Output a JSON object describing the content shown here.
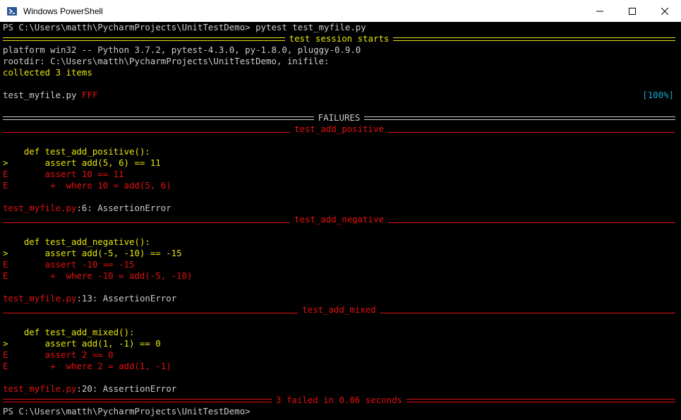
{
  "window": {
    "title": "Windows PowerShell",
    "icon": "powershell-icon",
    "controls": [
      "minimize-icon",
      "maximize-icon",
      "close-icon"
    ]
  },
  "console": {
    "prompt1": "PS C:\\Users\\matth\\PycharmProjects\\UnitTestDemo> pytest test_myfile.py",
    "session_header": "test session starts",
    "platform": "platform win32 -- Python 3.7.2, pytest-4.3.0, py-1.8.0, pluggy-0.9.0",
    "rootdir": "rootdir: C:\\Users\\matth\\PycharmProjects\\UnitTestDemo, inifile:",
    "collected": "collected 3 items",
    "file": "test_myfile.py",
    "file_result": "FFF",
    "progress": "[100%]",
    "failures_header": "FAILURES",
    "tests": [
      {
        "name": "test_add_positive",
        "def": "    def test_add_positive():",
        "assert_line": "        assert add(5, 6) == 11",
        "err1": "        assert 10 == 11",
        "err2": "         +  where 10 = add(5, 6)",
        "loc_file": "test_myfile.py",
        "loc_rest": ":6: AssertionError"
      },
      {
        "name": "test_add_negative",
        "def": "    def test_add_negative():",
        "assert_line": "        assert add(-5, -10) == -15",
        "err1": "        assert -10 == -15",
        "err2": "         +  where -10 = add(-5, -10)",
        "loc_file": "test_myfile.py",
        "loc_rest": ":13: AssertionError"
      },
      {
        "name": "test_add_mixed",
        "def": "    def test_add_mixed():",
        "assert_line": "        assert add(1, -1) == 0",
        "err1": "        assert 2 == 0",
        "err2": "         +  where 2 = add(1, -1)",
        "loc_file": "test_myfile.py",
        "loc_rest": ":20: AssertionError"
      }
    ],
    "arrow_marker": ">",
    "error_marker": "E",
    "summary": "3 failed in 0.06 seconds",
    "prompt2": "PS C:\\Users\\matth\\PycharmProjects\\UnitTestDemo>"
  }
}
